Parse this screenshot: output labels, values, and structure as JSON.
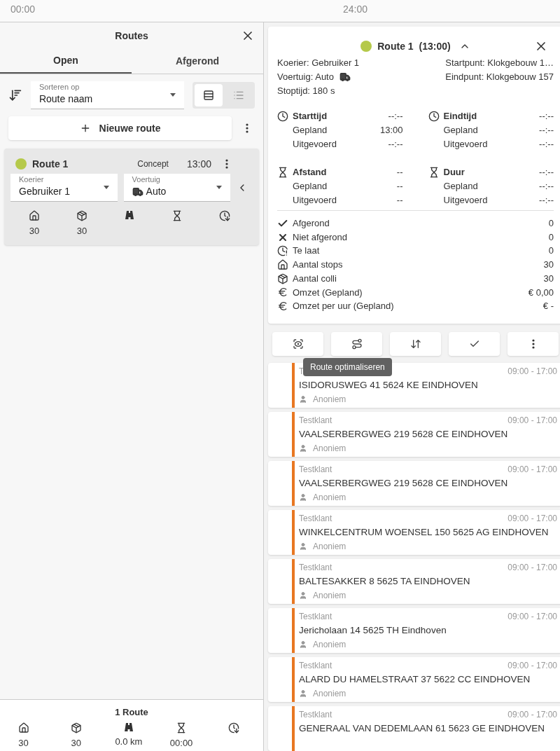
{
  "timeline": {
    "start": "00:00",
    "end": "24:00"
  },
  "routes_panel": {
    "title": "Routes",
    "tabs": [
      {
        "label": "Open",
        "selected": true
      },
      {
        "label": "Afgerond",
        "selected": false
      }
    ],
    "sort": {
      "label": "Sorteren op",
      "value": "Route naam"
    },
    "view_toggle": [
      {
        "kind": "detailed",
        "selected": true
      },
      {
        "kind": "compact",
        "selected": false
      }
    ],
    "new_route": "Nieuwe route",
    "route_cards": [
      {
        "name": "Route 1",
        "color": "#b5c94a",
        "status": "Concept",
        "time": "13:00",
        "courier": {
          "label": "Koerier",
          "value": "Gebruiker 1"
        },
        "vehicle": {
          "label": "Voertuig",
          "value": "Auto"
        },
        "stats": [
          {
            "kind": "stops",
            "value": "30"
          },
          {
            "kind": "parcels",
            "value": "30"
          },
          {
            "kind": "distance"
          },
          {
            "kind": "duration"
          },
          {
            "kind": "late"
          }
        ]
      }
    ],
    "footer": {
      "title": "1 Route",
      "stats": [
        {
          "kind": "stops",
          "value": "30"
        },
        {
          "kind": "parcels",
          "value": "30"
        },
        {
          "kind": "distance",
          "value": "0.0 km"
        },
        {
          "kind": "duration",
          "value": "00:00"
        },
        {
          "kind": "late"
        }
      ]
    }
  },
  "route_detail": {
    "title": "Route 1",
    "time": "(13:00)",
    "color": "#b5c94a",
    "info_left": [
      "Koerier: Gebruiker 1",
      "Voertuig: Auto",
      "Stoptijd: 180 s"
    ],
    "info_right": [
      "Startpunt: Klokgebouw 1…",
      "Eindpunt: Klokgebouw 157"
    ],
    "metric_groups": [
      {
        "kind": "clock",
        "title": "Starttijd",
        "value": "--:--",
        "rows": [
          {
            "label": "Gepland",
            "value": "13:00"
          },
          {
            "label": "Uitgevoerd",
            "value": "--:--"
          }
        ]
      },
      {
        "kind": "clock",
        "title": "Eindtijd",
        "value": "--:--",
        "rows": [
          {
            "label": "Gepland",
            "value": "--:--"
          },
          {
            "label": "Uitgevoerd",
            "value": "--:--"
          }
        ]
      },
      {
        "kind": "hourglass",
        "title": "Afstand",
        "value": "--",
        "rows": [
          {
            "label": "Gepland",
            "value": "--"
          },
          {
            "label": "Uitgevoerd",
            "value": "--"
          }
        ]
      },
      {
        "kind": "hourglass",
        "title": "Duur",
        "value": "--:--",
        "rows": [
          {
            "label": "Gepland",
            "value": "--:--"
          },
          {
            "label": "Uitgevoerd",
            "value": "--:--"
          }
        ]
      }
    ],
    "totals": [
      {
        "kind": "done",
        "label": "Afgerond",
        "value": "0"
      },
      {
        "kind": "failed",
        "label": "Niet afgerond",
        "value": "0"
      },
      {
        "kind": "late",
        "label": "Te laat",
        "value": "0"
      },
      {
        "kind": "stops",
        "label": "Aantal stops",
        "value": "30"
      },
      {
        "kind": "parcels",
        "label": "Aantal colli",
        "value": "30"
      },
      {
        "kind": "euro",
        "label": "Omzet (Gepland)",
        "value": "€ 0,00"
      },
      {
        "kind": "euro",
        "label": "Omzet per uur (Gepland)",
        "value": "€ -"
      }
    ]
  },
  "toolbar": [
    {
      "kind": "focus"
    },
    {
      "kind": "optimize",
      "tooltip": "Route optimaliseren"
    },
    {
      "kind": "sort"
    },
    {
      "kind": "check"
    },
    {
      "kind": "more"
    }
  ],
  "stops": [
    {
      "customer": "T",
      "window": "09:00 - 17:00",
      "address": "ISIDORUSWEG 41 5624 KE EINDHOVEN",
      "contact": "Anoniem"
    },
    {
      "customer": "Testklant",
      "window": "09:00 - 17:00",
      "address": "VAALSERBERGWEG 219 5628 CE EINDHOVEN",
      "contact": "Anoniem"
    },
    {
      "customer": "Testklant",
      "window": "09:00 - 17:00",
      "address": "VAALSERBERGWEG 219 5628 CE EINDHOVEN",
      "contact": "Anoniem"
    },
    {
      "customer": "Testklant",
      "window": "09:00 - 17:00",
      "address": "WINKELCENTRUM WOENSEL 150 5625 AG EINDHOVEN",
      "contact": "Anoniem"
    },
    {
      "customer": "Testklant",
      "window": "09:00 - 17:00",
      "address": "BALTESAKKER 8 5625 TA EINDHOVEN",
      "contact": "Anoniem"
    },
    {
      "customer": "Testklant",
      "window": "09:00 - 17:00",
      "address": "Jericholaan 14 5625 TH Eindhoven",
      "contact": "Anoniem"
    },
    {
      "customer": "Testklant",
      "window": "09:00 - 17:00",
      "address": "ALARD DU HAMELSTRAAT 37 5622 CC EINDHOVEN",
      "contact": "Anoniem"
    },
    {
      "customer": "Testklant",
      "window": "09:00 - 17:00",
      "address": "GENERAAL VAN DEDEMLAAN 61 5623 GE EINDHOVEN"
    }
  ]
}
